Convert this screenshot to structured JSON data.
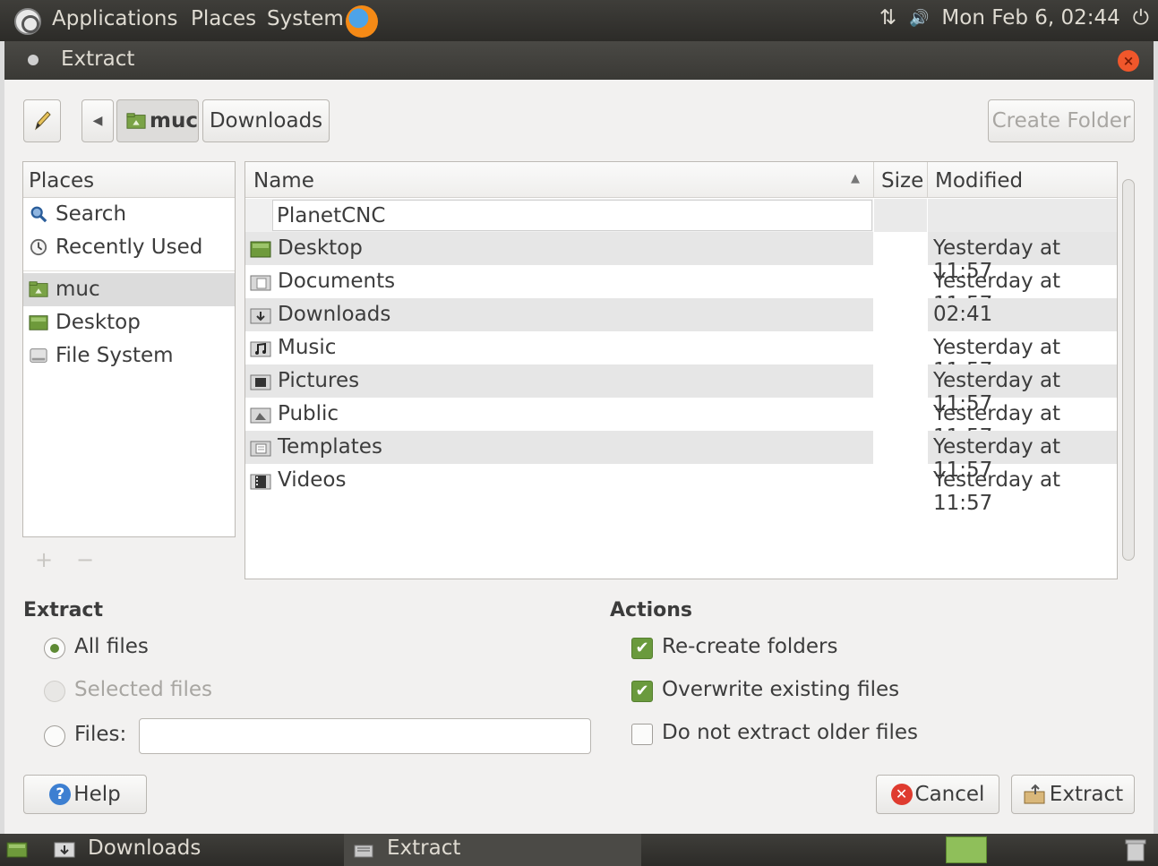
{
  "top_panel": {
    "menus": [
      "Applications",
      "Places",
      "System"
    ],
    "clock": "Mon Feb 6, 02:44",
    "network_symbol": "⇅",
    "volume_symbol": "🔊",
    "power_symbol": "⏻"
  },
  "window": {
    "title": "Extract"
  },
  "toolbar": {
    "path_buttons": [
      "muc",
      "Downloads"
    ],
    "create_folder_label": "Create Folder"
  },
  "places": {
    "header": "Places",
    "items": [
      {
        "label": "Search",
        "icon": "search-icon"
      },
      {
        "label": "Recently Used",
        "icon": "clock-icon"
      },
      {
        "label": "muc",
        "icon": "home-folder-icon"
      },
      {
        "label": "Desktop",
        "icon": "desktop-icon"
      },
      {
        "label": "File System",
        "icon": "drive-icon"
      }
    ],
    "add_symbol": "+",
    "remove_symbol": "−"
  },
  "filelist": {
    "columns": {
      "name": "Name",
      "size": "Size",
      "modified": "Modified"
    },
    "sort_indicator": "▲",
    "new_folder_value": "PlanetCNC",
    "rows": [
      {
        "name": "Desktop",
        "size": "",
        "modified": "Yesterday at 11:57",
        "icon": "desktop-folder-icon"
      },
      {
        "name": "Documents",
        "size": "",
        "modified": "Yesterday at 11:57",
        "icon": "documents-folder-icon"
      },
      {
        "name": "Downloads",
        "size": "",
        "modified": "02:41",
        "icon": "downloads-folder-icon"
      },
      {
        "name": "Music",
        "size": "",
        "modified": "Yesterday at 11:57",
        "icon": "music-folder-icon"
      },
      {
        "name": "Pictures",
        "size": "",
        "modified": "Yesterday at 11:57",
        "icon": "pictures-folder-icon"
      },
      {
        "name": "Public",
        "size": "",
        "modified": "Yesterday at 11:57",
        "icon": "public-folder-icon"
      },
      {
        "name": "Templates",
        "size": "",
        "modified": "Yesterday at 11:57",
        "icon": "templates-folder-icon"
      },
      {
        "name": "Videos",
        "size": "",
        "modified": "Yesterday at 11:57",
        "icon": "videos-folder-icon"
      }
    ]
  },
  "extract_section": {
    "title": "Extract",
    "all_files": "All files",
    "selected_files": "Selected files",
    "files_label": "Files:",
    "files_value": ""
  },
  "actions_section": {
    "title": "Actions",
    "recreate_folders": "Re-create folders",
    "overwrite_existing": "Overwrite existing files",
    "no_extract_older": "Do not extract older files"
  },
  "buttons": {
    "help": "Help",
    "cancel": "Cancel",
    "extract": "Extract"
  },
  "taskbar": {
    "tasks": [
      "Downloads",
      "Extract"
    ]
  },
  "colors": {
    "accent_green": "#6a9a3d",
    "panel_dark": "#3a3935",
    "close_orange": "#f0572b"
  }
}
